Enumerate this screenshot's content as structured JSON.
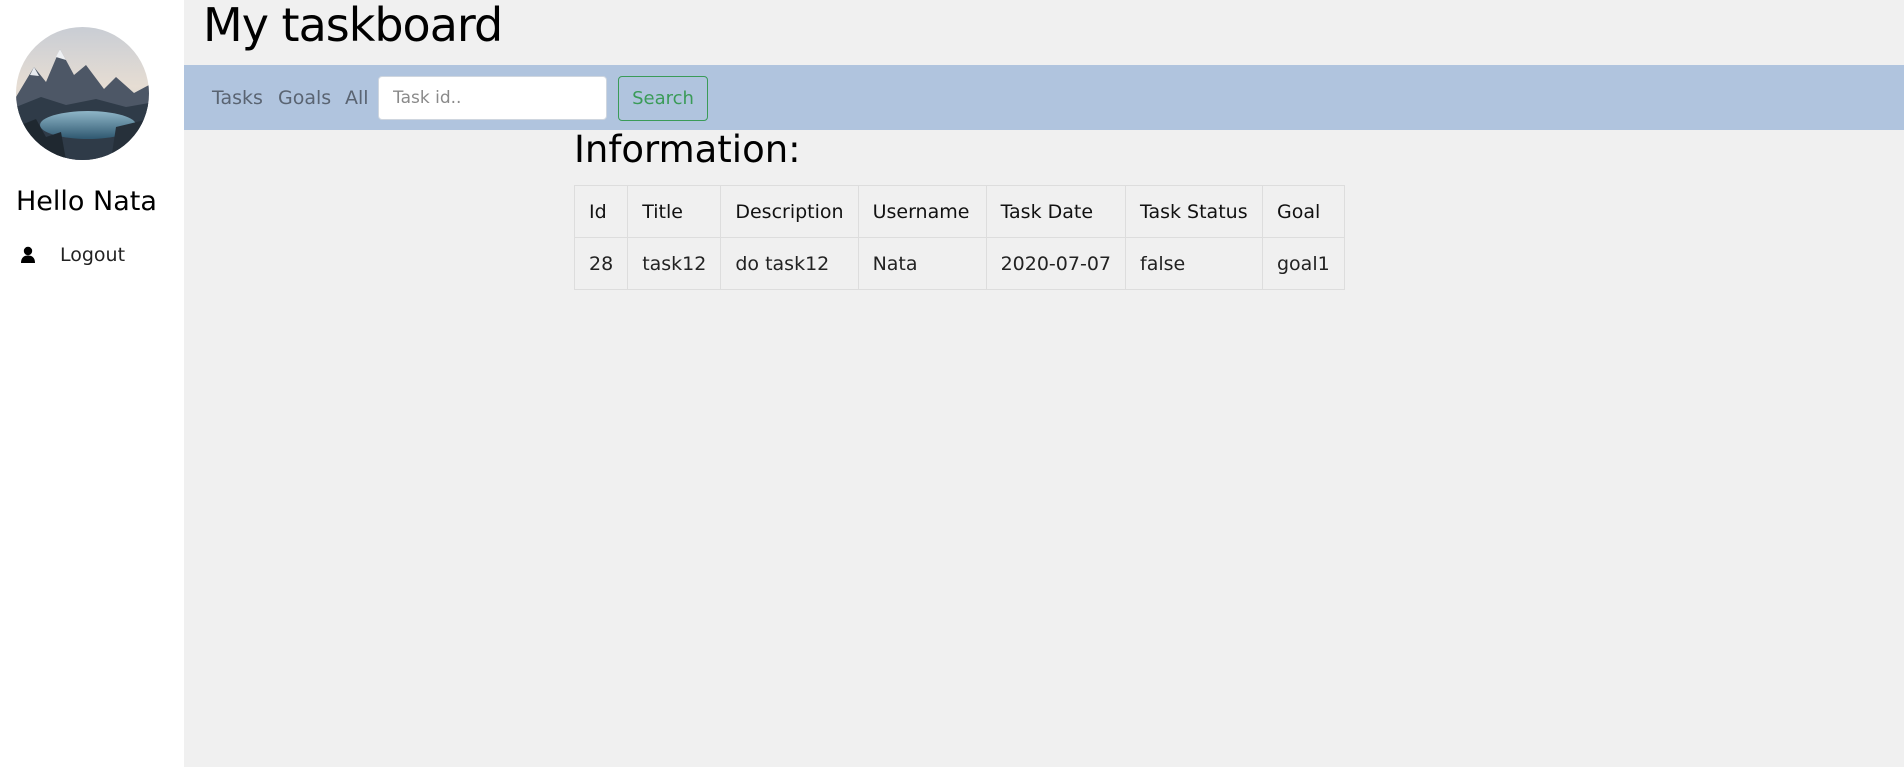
{
  "sidebar": {
    "avatar_icon": "mountain-lake-avatar",
    "greeting": "Hello Nata",
    "logout_icon": "user-icon",
    "logout_label": "Logout"
  },
  "header": {
    "title": "My taskboard"
  },
  "navbar": {
    "background": "#b0c4de",
    "links": [
      "Tasks",
      "Goals",
      "All"
    ],
    "search_placeholder": "Task id..",
    "search_value": "",
    "search_button_label": "Search",
    "search_button_color": "#3a9b58"
  },
  "main": {
    "heading": "Information:",
    "table": {
      "columns": [
        "Id",
        "Title",
        "Description",
        "Username",
        "Task Date",
        "Task Status",
        "Goal"
      ],
      "rows": [
        [
          "28",
          "task12",
          "do task12",
          "Nata",
          "2020-07-07",
          "false",
          "goal1"
        ]
      ]
    }
  }
}
